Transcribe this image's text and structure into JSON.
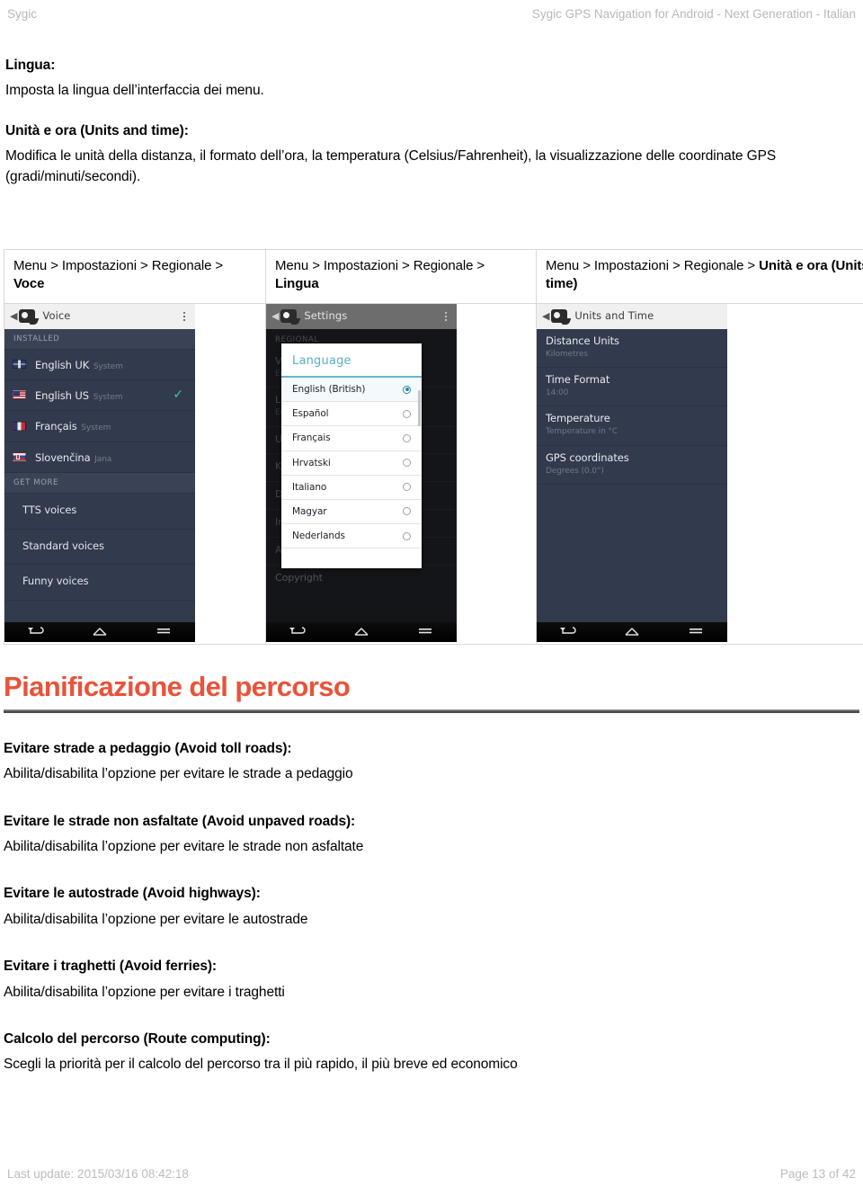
{
  "header": {
    "left": "Sygic",
    "right": "Sygic GPS Navigation for Android - Next Generation - Italian"
  },
  "sections": {
    "lingua": {
      "heading": "Lingua:",
      "body": "Imposta la lingua dell’interfaccia dei menu."
    },
    "unita": {
      "heading": "Unità e ora (Units and time):",
      "body": "Modifica le unità della distanza, il formato dell’ora, la temperatura (Celsius/Fahrenheit), la visualizzazione delle coordinate GPS (gradi/minuti/secondi)."
    }
  },
  "breadcrumbs": [
    {
      "prefix": "Menu > Impostazioni > Regionale > ",
      "bold": "Voce"
    },
    {
      "prefix": "Menu > Impostazioni > Regionale > ",
      "bold": "Lingua"
    },
    {
      "prefix": "Menu > Impostazioni > Regionale > ",
      "bold": "Unità e ora (Units and time)"
    }
  ],
  "screenshot_voice": {
    "actionbar_title": "Voice",
    "section_installed": "INSTALLED",
    "voices": [
      {
        "name": "English UK",
        "sub": "System",
        "flag": "uk",
        "checked": false
      },
      {
        "name": "English US",
        "sub": "System",
        "flag": "us",
        "checked": true
      },
      {
        "name": "Français",
        "sub": "System",
        "flag": "fr",
        "checked": false
      },
      {
        "name": "Slovenčina",
        "sub": "Jana",
        "flag": "sk",
        "checked": false
      }
    ],
    "section_get_more": "GET MORE",
    "more": [
      "TTS voices",
      "Standard voices",
      "Funny voices"
    ],
    "check_glyph": "✓",
    "check_color": "#3fcf8e"
  },
  "screenshot_language": {
    "actionbar_title": "Settings",
    "background_rows": [
      {
        "label": "REGIONAL",
        "type": "section"
      },
      {
        "label": "Voice",
        "sub": "English US",
        "type": "row"
      },
      {
        "label": "Language",
        "sub": "English (British)",
        "type": "row"
      },
      {
        "label": "Units and Time",
        "sub": "",
        "type": "row"
      },
      {
        "label": "Keyboard",
        "sub": "",
        "type": "row"
      },
      {
        "label": "Data",
        "sub": "",
        "type": "row"
      },
      {
        "label": "Info",
        "sub": "",
        "type": "row"
      },
      {
        "label": "About",
        "sub": "",
        "type": "row"
      }
    ],
    "copyright_row": "Copyright",
    "dialog": {
      "title": "Language",
      "options": [
        {
          "label": "English (British)",
          "selected": true
        },
        {
          "label": "Español",
          "selected": false
        },
        {
          "label": "Français",
          "selected": false
        },
        {
          "label": "Hrvatski",
          "selected": false
        },
        {
          "label": "Italiano",
          "selected": false
        },
        {
          "label": "Magyar",
          "selected": false
        },
        {
          "label": "Nederlands",
          "selected": false
        }
      ],
      "accent_color": "#63b8cf",
      "radio_color": "#2f83a8"
    }
  },
  "screenshot_units": {
    "actionbar_title": "Units and Time",
    "rows": [
      {
        "name": "Distance Units",
        "value": "Kilometres"
      },
      {
        "name": "Time Format",
        "value": "14:00"
      },
      {
        "name": "Temperature",
        "value": "Temperature in °C"
      },
      {
        "name": "GPS coordinates",
        "value": "Degrees (0.0°)"
      }
    ]
  },
  "route_section": {
    "title": "Pianificazione del percorso",
    "title_color": "#e8533a",
    "items": [
      {
        "heading": "Evitare strade a pedaggio (Avoid toll roads):",
        "body": "Abilita/disabilita l’opzione per evitare le strade a pedaggio"
      },
      {
        "heading": "Evitare le strade non asfaltate (Avoid unpaved roads):",
        "body": "Abilita/disabilita l’opzione per evitare le strade non asfaltate"
      },
      {
        "heading": "Evitare le autostrade (Avoid highways):",
        "body": "Abilita/disabilita l’opzione per evitare le autostrade"
      },
      {
        "heading": "Evitare i traghetti (Avoid ferries):",
        "body": "Abilita/disabilita l’opzione per evitare i traghetti"
      },
      {
        "heading": "Calcolo del percorso (Route computing):",
        "body": "Scegli la priorità per il calcolo del percorso tra il più rapido, il più breve ed economico"
      }
    ]
  },
  "footer": {
    "left": "Last update: 2015/03/16 08:42:18",
    "right": "Page 13 of 42"
  }
}
